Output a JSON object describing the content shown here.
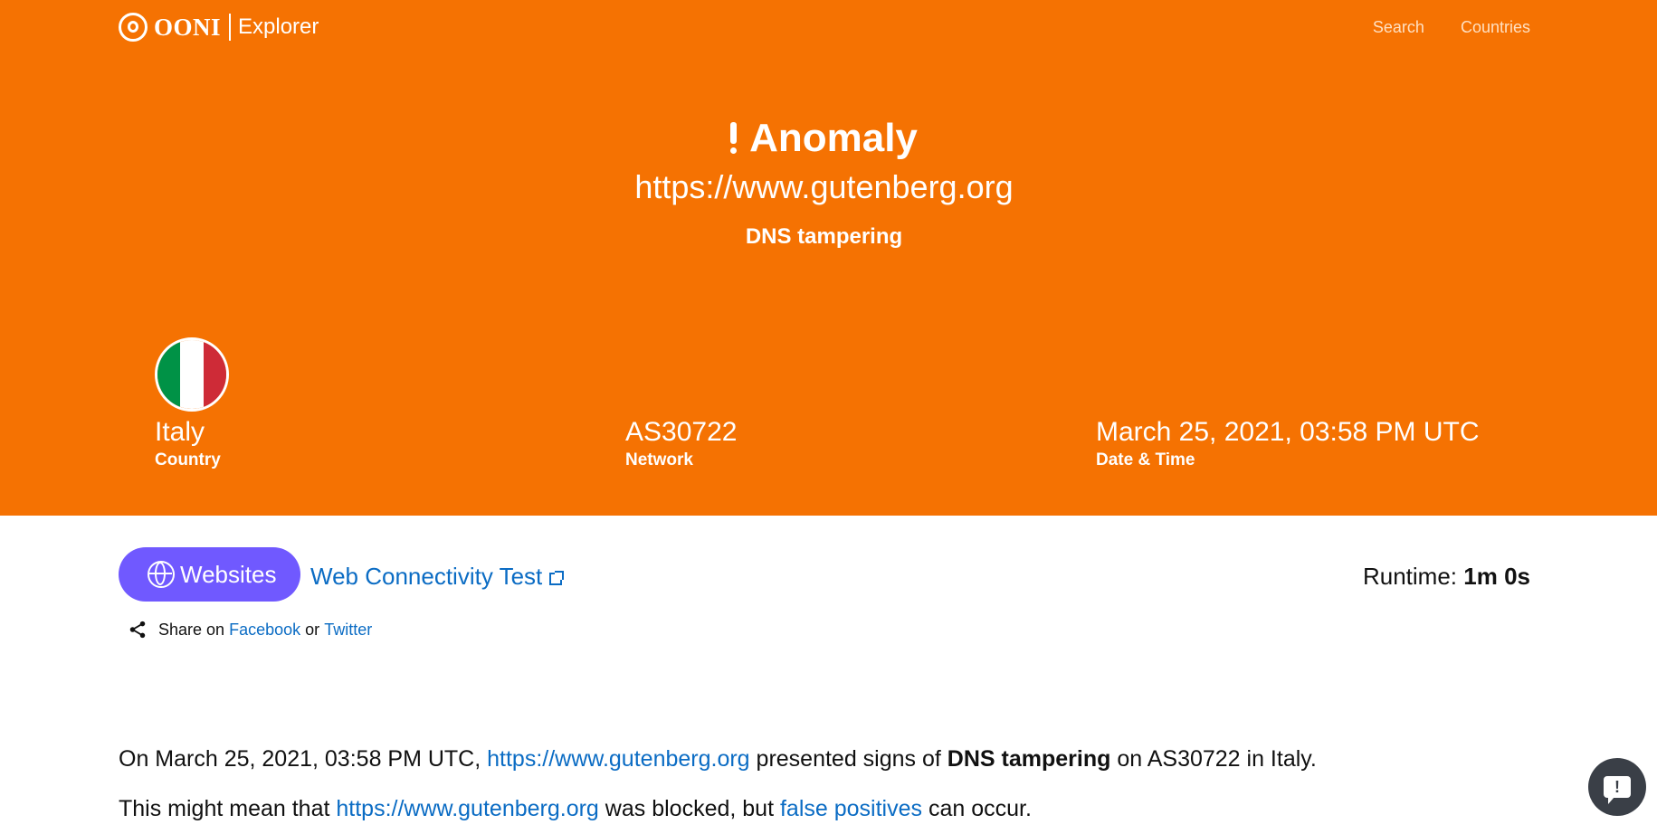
{
  "nav": {
    "logo_text": "OONI",
    "logo_sub": "Explorer",
    "links": [
      "Search",
      "Countries"
    ]
  },
  "measurement": {
    "status": "Anomaly",
    "url": "https://www.gutenberg.org",
    "blocking": "DNS tampering"
  },
  "info": {
    "country": {
      "value": "Italy",
      "label": "Country"
    },
    "network": {
      "value": "AS30722",
      "label": "Network"
    },
    "datetime": {
      "value": "March 25, 2021, 03:58 PM UTC",
      "label": "Date & Time"
    }
  },
  "flag_colors": [
    "#009246",
    "#ffffff",
    "#ce2b37"
  ],
  "details": {
    "category_button": "Websites",
    "test_name": "Web Connectivity Test",
    "runtime_label": "Runtime:",
    "runtime_value": "1m 0s",
    "share": {
      "prefix": "Share on",
      "facebook": "Facebook",
      "or": "or",
      "twitter": "Twitter"
    }
  },
  "summary": {
    "line1": {
      "prefix": "On March 25, 2021, 03:58 PM UTC,",
      "url": "https://www.gutenberg.org",
      "middle": "presented signs of",
      "blocking": "DNS tampering",
      "suffix": "on AS30722 in Italy."
    },
    "line2": {
      "prefix": "This might mean that",
      "url": "https://www.gutenberg.org",
      "middle": "was blocked, but",
      "link": "false positives",
      "suffix": "can occur."
    }
  },
  "colors": {
    "hero": "#f57202",
    "websites_button": "#7059ff",
    "link": "#0b6cc4",
    "feedback": "#3a3f47"
  },
  "icons": [
    "ooni-logo-icon",
    "anomaly-icon",
    "globe-icon",
    "external-link-icon",
    "share-icon",
    "feedback-icon"
  ]
}
